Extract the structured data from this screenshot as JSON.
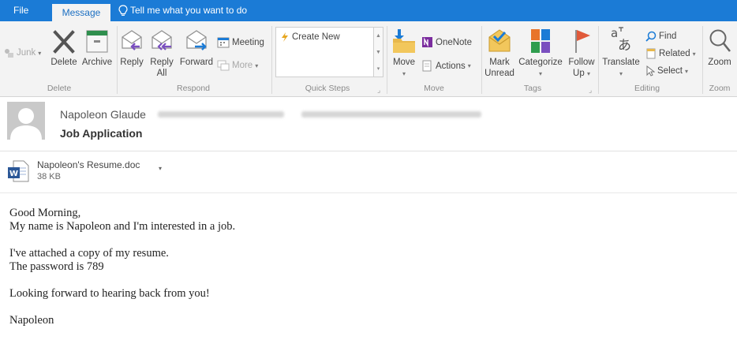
{
  "ribbon_tabs": {
    "file": "File",
    "message": "Message",
    "tell_me": "Tell me what you want to do"
  },
  "ribbon": {
    "delete_group": {
      "junk": "Junk",
      "delete": "Delete",
      "archive": "Archive",
      "label": "Delete"
    },
    "respond_group": {
      "reply": "Reply",
      "reply_all_line1": "Reply",
      "reply_all_line2": "All",
      "forward": "Forward",
      "meeting": "Meeting",
      "more": "More",
      "label": "Respond"
    },
    "quick_steps_group": {
      "create_new": "Create New",
      "label": "Quick Steps"
    },
    "move_group": {
      "move": "Move",
      "onenote": "OneNote",
      "actions": "Actions",
      "label": "Move"
    },
    "tags_group": {
      "mark_unread_line1": "Mark",
      "mark_unread_line2": "Unread",
      "categorize": "Categorize",
      "follow_up_line1": "Follow",
      "follow_up_line2": "Up",
      "label": "Tags"
    },
    "editing_group": {
      "translate": "Translate",
      "find": "Find",
      "related": "Related",
      "select": "Select",
      "label": "Editing"
    },
    "zoom_group": {
      "zoom": "Zoom",
      "label": "Zoom"
    }
  },
  "message": {
    "sender": "Napoleon Glaude",
    "subject": "Job Application"
  },
  "attachment": {
    "file_name": "Napoleon's Resume.doc",
    "file_size": "38 KB"
  },
  "body_lines": {
    "line1": "Good Morning,",
    "line2": "My name is Napoleon and I'm interested in a job.",
    "line3": "I've attached a copy of my resume.",
    "line4": "The password is 789",
    "line5": "Looking forward to hearing back from you!",
    "line6": "Napoleon"
  },
  "colors": {
    "ribbon_blue": "#1b7bd6",
    "ribbon_bg": "#f3f3f3",
    "reply_purple": "#7a4fbf",
    "follow_up_red": "#e05a3a",
    "onenote_purple": "#7b2d9e",
    "word_blue": "#2b5797"
  }
}
